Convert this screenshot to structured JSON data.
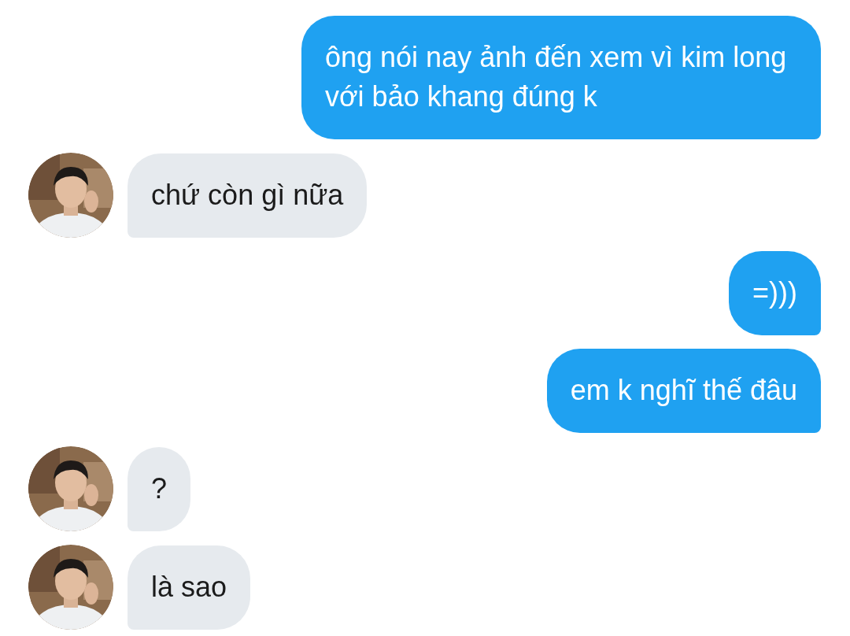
{
  "messages": [
    {
      "kind": "sent",
      "text": "ông nói nay ảnh đến xem vì kim long với bảo khang đúng k"
    },
    {
      "kind": "received",
      "text": "chứ còn gì nữa"
    },
    {
      "kind": "sent",
      "text": "=)))"
    },
    {
      "kind": "sent",
      "text": "em k nghĩ thế đâu"
    },
    {
      "kind": "received",
      "text": "?"
    },
    {
      "kind": "received",
      "text": "là sao"
    }
  ]
}
